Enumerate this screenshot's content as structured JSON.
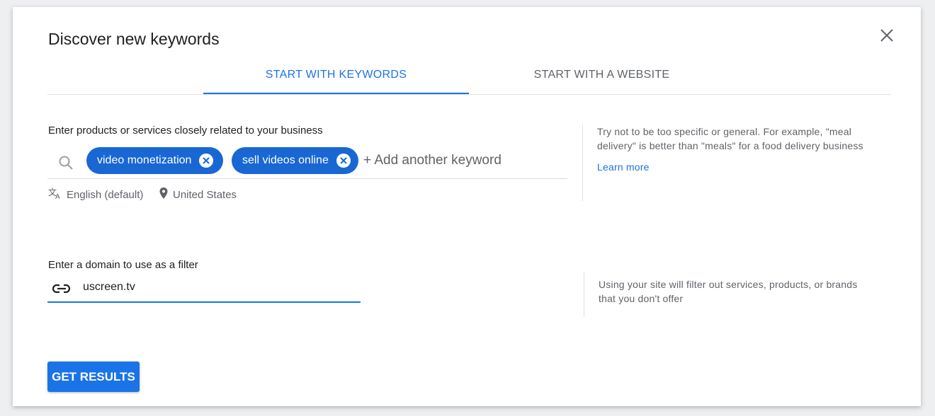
{
  "dialog": {
    "title": "Discover new keywords",
    "close_icon": "close-icon"
  },
  "tabs": [
    {
      "label": "START WITH KEYWORDS",
      "active": true
    },
    {
      "label": "START WITH A WEBSITE",
      "active": false
    }
  ],
  "keywords": {
    "label": "Enter products or services closely related to your business",
    "chips": [
      "video monetization",
      "sell videos online"
    ],
    "placeholder": "+ Add another keyword",
    "language": "English (default)",
    "location": "United States",
    "hint": "Try not to be too specific or general. For example, \"meal delivery\" is better than \"meals\" for a food delivery business",
    "learn_more": "Learn more"
  },
  "domain": {
    "label": "Enter a domain to use as a filter",
    "value": "uscreen.tv",
    "hint": "Using your site will filter out services, products, or brands that you don't offer"
  },
  "actions": {
    "get_results": "GET RESULTS"
  },
  "colors": {
    "accent": "#1a73e8",
    "chip": "#1967d2"
  }
}
